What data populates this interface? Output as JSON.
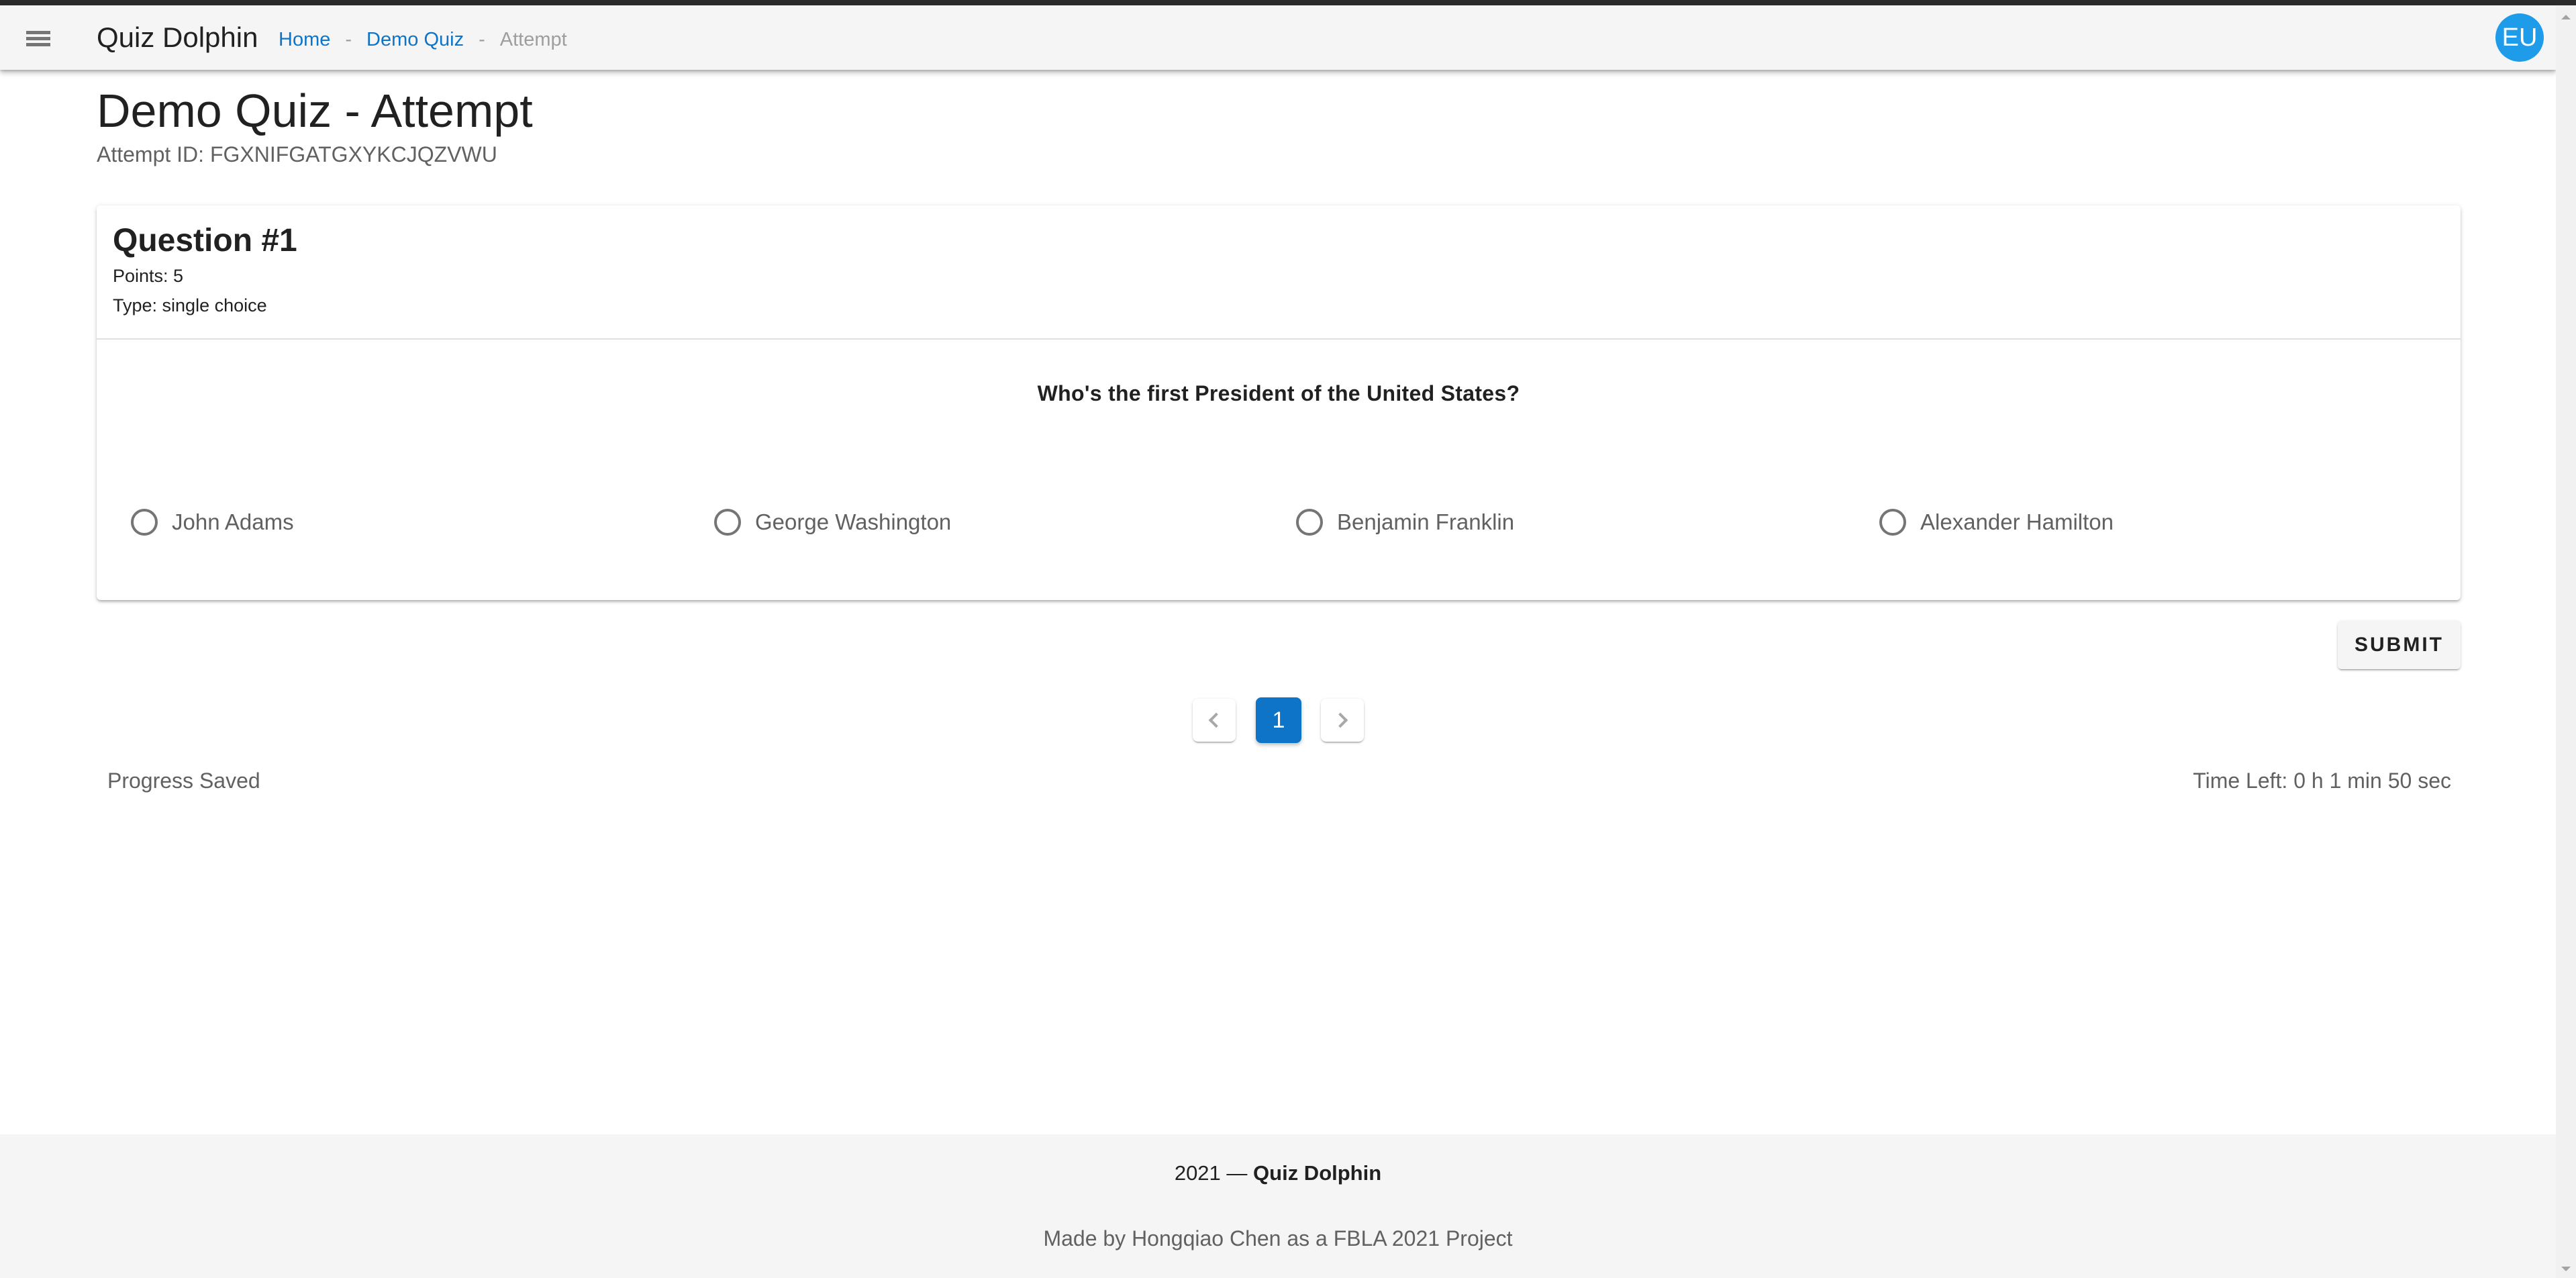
{
  "app": {
    "title": "Quiz Dolphin",
    "menu_icon": "hamburger-menu-icon",
    "user_initials": "EU",
    "accent_color": "#0d74c8",
    "avatar_color": "#1e9be9"
  },
  "breadcrumb": {
    "items": [
      {
        "label": "Home",
        "link": true
      },
      {
        "label": "Demo Quiz",
        "link": true
      },
      {
        "label": "Attempt",
        "link": false
      }
    ],
    "separator": "-"
  },
  "page": {
    "title": "Demo Quiz - Attempt",
    "attempt_id": "Attempt ID: FGXNIFGATGXYKCJQZVWU"
  },
  "question": {
    "title": "Question #1",
    "points": "Points: 5",
    "type": "Type: single choice",
    "text": "Who's the first President of the United States?",
    "options": [
      {
        "label": "John Adams",
        "selected": false
      },
      {
        "label": "George Washington",
        "selected": false
      },
      {
        "label": "Benjamin Franklin",
        "selected": false
      },
      {
        "label": "Alexander Hamilton",
        "selected": false
      }
    ]
  },
  "actions": {
    "submit_label": "SUBMIT"
  },
  "pagination": {
    "prev_icon": "chevron-left-icon",
    "next_icon": "chevron-right-icon",
    "pages": [
      "1"
    ],
    "current_page": "1"
  },
  "status": {
    "progress": "Progress Saved",
    "time_left": "Time Left: 0 h 1 min 50 sec"
  },
  "footer": {
    "year_prefix": "2021 — ",
    "brand": "Quiz Dolphin",
    "credit": "Made by Hongqiao Chen as a FBLA 2021 Project"
  }
}
